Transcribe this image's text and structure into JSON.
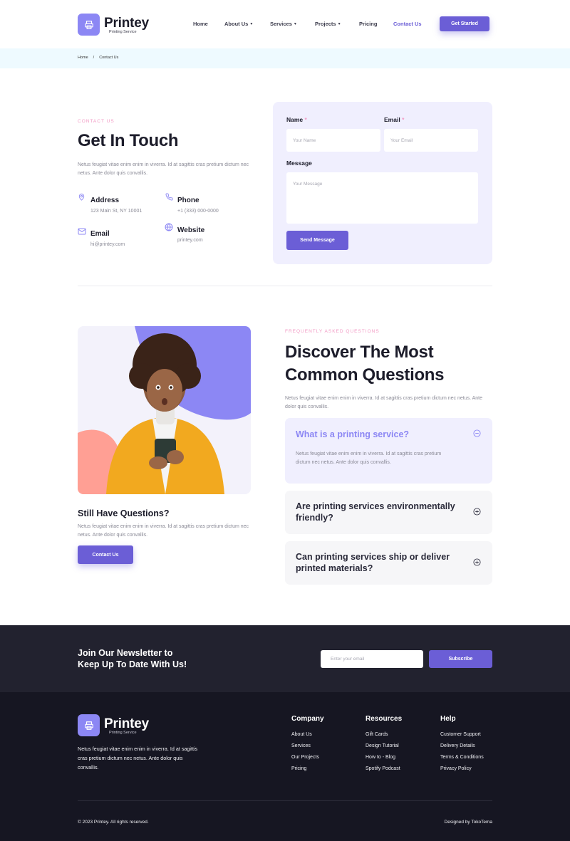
{
  "brand": {
    "name": "Printey",
    "tagline": "Printing Service",
    "logo_icon": "printer-icon",
    "accent": "#6b5ed6",
    "accent_light": "#8c87f4",
    "pink": "#f29ac4"
  },
  "nav": {
    "items": [
      {
        "label": "Home",
        "has_caret": false,
        "active": false
      },
      {
        "label": "About Us",
        "has_caret": true,
        "active": false
      },
      {
        "label": "Services",
        "has_caret": true,
        "active": false
      },
      {
        "label": "Projects",
        "has_caret": true,
        "active": false
      },
      {
        "label": "Pricing",
        "has_caret": false,
        "active": false
      },
      {
        "label": "Contact Us",
        "has_caret": false,
        "active": true
      }
    ],
    "cta": "Get Started"
  },
  "breadcrumb": {
    "home": "Home",
    "separator": "/",
    "current": "Contact Us"
  },
  "contact": {
    "eyebrow": "CONTACT US",
    "title": "Get In Touch",
    "description": "Netus feugiat vitae enim enim in viverra. Id at sagittis cras pretium dictum nec netus. Ante dolor quis convallis.",
    "info": [
      {
        "icon": "map-pin-icon",
        "title": "Address",
        "value": "123 Main St, NY 10001"
      },
      {
        "icon": "phone-icon",
        "title": "Phone",
        "value": "+1 (333) 000-0000"
      },
      {
        "icon": "mail-icon",
        "title": "Email",
        "value": "hi@printey.com"
      },
      {
        "icon": "globe-icon",
        "title": "Website",
        "value": "printey.com"
      }
    ],
    "form": {
      "name_label": "Name",
      "name_placeholder": "Your Name",
      "email_label": "Email",
      "email_placeholder": "Your Email",
      "required_mark": "*",
      "message_label": "Message",
      "message_placeholder": "Your Message",
      "submit": "Send Message"
    }
  },
  "faq": {
    "eyebrow": "FREQUENTLY ASKED QUESTIONS",
    "title_line1": "Discover The Most",
    "title_line2": "Common Questions",
    "description": "Netus feugiat vitae enim enim in viverra. Id at sagittis cras pretium dictum nec netus. Ante dolor quis convallis.",
    "still_title": "Still Have Questions?",
    "still_text": "Netus feugiat vitae enim enim in viverra. Id at sagittis cras pretium dictum nec netus. Ante dolor quis convallis.",
    "still_button": "Contact Us",
    "items": [
      {
        "question": "What is a printing service?",
        "answer": "Netus feugiat vitae enim enim in viverra. Id at sagittis cras pretium dictum nec netus. Ante dolor quis convallis.",
        "expanded": true,
        "icon": "minus-circle-icon"
      },
      {
        "question": "Are printing services environmentally friendly?",
        "expanded": false,
        "icon": "plus-circle-icon"
      },
      {
        "question": "Can printing services ship or deliver printed materials?",
        "expanded": false,
        "icon": "plus-circle-icon"
      }
    ]
  },
  "newsletter": {
    "title_line1": "Join Our Newsletter to",
    "title_line2": "Keep Up To Date With Us!",
    "placeholder": "Enter your email",
    "button": "Subscribe"
  },
  "footer": {
    "description": "Netus feugiat vitae enim enim in viverra. Id at sagittis cras pretium dictum nec netus. Ante dolor quis convallis.",
    "columns": [
      {
        "title": "Company",
        "links": [
          "About Us",
          "Services",
          "Our Projects",
          "Pricing"
        ]
      },
      {
        "title": "Resources",
        "links": [
          "Gift Cards",
          "Design Tutorial",
          "How to - Blog",
          "Spotify Podcast"
        ]
      },
      {
        "title": "Help",
        "links": [
          "Customer Support",
          "Delivery Details",
          "Terms & Conditions",
          "Privacy Policy"
        ]
      }
    ],
    "copyright": "© 2023 Printey. All rights reserved.",
    "credit": "Designed by TokoTema"
  }
}
